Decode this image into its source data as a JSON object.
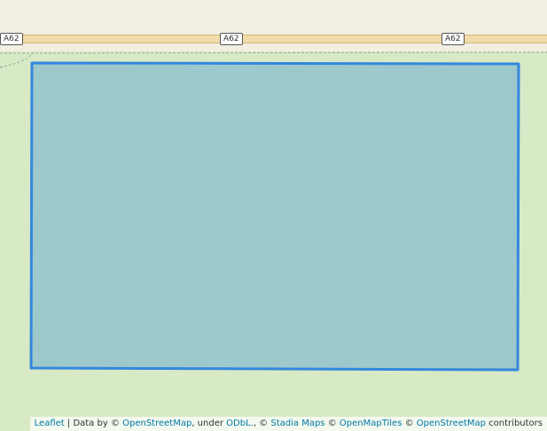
{
  "map": {
    "colors": {
      "land": "#d8e9c5",
      "built_area": "#f2efe2",
      "road_fill": "#f0dca8",
      "road_casing": "#d4b87e",
      "polygon_stroke": "#3388dd",
      "polygon_fill": "#9dc8cc",
      "boundary_dash": "#9aaa94"
    },
    "road_labels": [
      "A62",
      "A62",
      "A62"
    ],
    "polygon": {
      "description_shape": "rectangle"
    }
  },
  "attribution": {
    "leaflet": "Leaflet",
    "sep1": " | Data by © ",
    "osm": "OpenStreetMap",
    "under": ", under ",
    "odbl": "ODbL.",
    "sep2": ", © ",
    "stadia": "Stadia Maps",
    "sep3": " © ",
    "openmaptiles": "OpenMapTiles",
    "sep4": " © ",
    "osm2": "OpenStreetMap",
    "contributors": " contributors"
  }
}
